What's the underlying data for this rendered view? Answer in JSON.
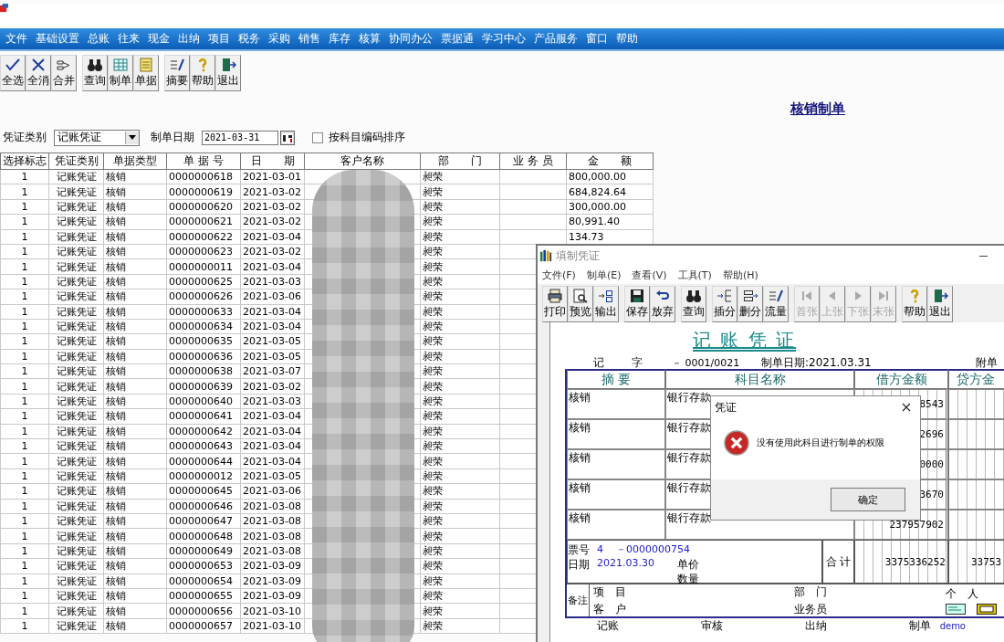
{
  "menu": [
    "文件",
    "基础设置",
    "总账",
    "往来",
    "现金",
    "出纳",
    "项目",
    "税务",
    "采购",
    "销售",
    "库存",
    "核算",
    "协同办公",
    "票据通",
    "学习中心",
    "产品服务",
    "窗口",
    "帮助"
  ],
  "toolbar_groups": [
    [
      "全选",
      "全消",
      "合并"
    ],
    [
      "查询",
      "制单",
      "单据"
    ],
    [
      "摘要",
      "帮助",
      "退出"
    ]
  ],
  "page_title": "核销制单",
  "filters": {
    "voucher_type_label": "凭证类别",
    "voucher_type_value": "记账凭证",
    "date_label": "制单日期",
    "date_value": "2021-03-31",
    "sort_checkbox": {
      "label": "按科目编码排序",
      "checked": false
    }
  },
  "table": {
    "columns": [
      "选择标志",
      "凭证类别",
      "单据类型",
      "单 据 号",
      "日　　期",
      "客户名称",
      "部　　门",
      "业 务 员",
      "金　　额"
    ],
    "rows": [
      {
        "flag": "1",
        "voucher_type": "记账凭证",
        "doc_type": "核销",
        "doc_no": "0000000618",
        "date": "2021-03-01",
        "department": "昶荣",
        "amount": "800,000.00"
      },
      {
        "flag": "1",
        "voucher_type": "记账凭证",
        "doc_type": "核销",
        "doc_no": "0000000619",
        "date": "2021-03-02",
        "department": "昶荣",
        "amount": "684,824.64"
      },
      {
        "flag": "1",
        "voucher_type": "记账凭证",
        "doc_type": "核销",
        "doc_no": "0000000620",
        "date": "2021-03-02",
        "department": "昶荣",
        "amount": "300,000.00"
      },
      {
        "flag": "1",
        "voucher_type": "记账凭证",
        "doc_type": "核销",
        "doc_no": "0000000621",
        "date": "2021-03-02",
        "department": "昶荣",
        "amount": "80,991.40"
      },
      {
        "flag": "1",
        "voucher_type": "记账凭证",
        "doc_type": "核销",
        "doc_no": "0000000622",
        "date": "2021-03-04",
        "department": "昶荣",
        "amount": "134.73"
      },
      {
        "flag": "1",
        "voucher_type": "记账凭证",
        "doc_type": "核销",
        "doc_no": "0000000623",
        "date": "2021-03-02",
        "department": "昶荣"
      },
      {
        "flag": "1",
        "voucher_type": "记账凭证",
        "doc_type": "核销",
        "doc_no": "0000000011",
        "date": "2021-03-04",
        "department": "昶荣"
      },
      {
        "flag": "1",
        "voucher_type": "记账凭证",
        "doc_type": "核销",
        "doc_no": "0000000625",
        "date": "2021-03-03",
        "department": "昶荣"
      },
      {
        "flag": "1",
        "voucher_type": "记账凭证",
        "doc_type": "核销",
        "doc_no": "0000000626",
        "date": "2021-03-06",
        "department": "昶荣"
      },
      {
        "flag": "1",
        "voucher_type": "记账凭证",
        "doc_type": "核销",
        "doc_no": "0000000633",
        "date": "2021-03-04",
        "department": "昶荣"
      },
      {
        "flag": "1",
        "voucher_type": "记账凭证",
        "doc_type": "核销",
        "doc_no": "0000000634",
        "date": "2021-03-04",
        "department": "昶荣"
      },
      {
        "flag": "1",
        "voucher_type": "记账凭证",
        "doc_type": "核销",
        "doc_no": "0000000635",
        "date": "2021-03-05",
        "department": "昶荣"
      },
      {
        "flag": "1",
        "voucher_type": "记账凭证",
        "doc_type": "核销",
        "doc_no": "0000000636",
        "date": "2021-03-05",
        "department": "昶荣"
      },
      {
        "flag": "1",
        "voucher_type": "记账凭证",
        "doc_type": "核销",
        "doc_no": "0000000638",
        "date": "2021-03-07",
        "department": "昶荣"
      },
      {
        "flag": "1",
        "voucher_type": "记账凭证",
        "doc_type": "核销",
        "doc_no": "0000000639",
        "date": "2021-03-02",
        "department": "昶荣"
      },
      {
        "flag": "1",
        "voucher_type": "记账凭证",
        "doc_type": "核销",
        "doc_no": "0000000640",
        "date": "2021-03-03",
        "department": "昶荣"
      },
      {
        "flag": "1",
        "voucher_type": "记账凭证",
        "doc_type": "核销",
        "doc_no": "0000000641",
        "date": "2021-03-04",
        "department": "昶荣"
      },
      {
        "flag": "1",
        "voucher_type": "记账凭证",
        "doc_type": "核销",
        "doc_no": "0000000642",
        "date": "2021-03-04",
        "department": "昶荣"
      },
      {
        "flag": "1",
        "voucher_type": "记账凭证",
        "doc_type": "核销",
        "doc_no": "0000000643",
        "date": "2021-03-04",
        "department": "昶荣"
      },
      {
        "flag": "1",
        "voucher_type": "记账凭证",
        "doc_type": "核销",
        "doc_no": "0000000644",
        "date": "2021-03-04",
        "department": "昶荣"
      },
      {
        "flag": "1",
        "voucher_type": "记账凭证",
        "doc_type": "核销",
        "doc_no": "0000000012",
        "date": "2021-03-05",
        "department": "昶荣"
      },
      {
        "flag": "1",
        "voucher_type": "记账凭证",
        "doc_type": "核销",
        "doc_no": "0000000645",
        "date": "2021-03-06",
        "department": "昶荣"
      },
      {
        "flag": "1",
        "voucher_type": "记账凭证",
        "doc_type": "核销",
        "doc_no": "0000000646",
        "date": "2021-03-08",
        "department": "昶荣"
      },
      {
        "flag": "1",
        "voucher_type": "记账凭证",
        "doc_type": "核销",
        "doc_no": "0000000647",
        "date": "2021-03-08",
        "department": "昶荣"
      },
      {
        "flag": "1",
        "voucher_type": "记账凭证",
        "doc_type": "核销",
        "doc_no": "0000000648",
        "date": "2021-03-08",
        "department": "昶荣"
      },
      {
        "flag": "1",
        "voucher_type": "记账凭证",
        "doc_type": "核销",
        "doc_no": "0000000649",
        "date": "2021-03-08",
        "department": "昶荣"
      },
      {
        "flag": "1",
        "voucher_type": "记账凭证",
        "doc_type": "核销",
        "doc_no": "0000000653",
        "date": "2021-03-09",
        "department": "昶荣"
      },
      {
        "flag": "1",
        "voucher_type": "记账凭证",
        "doc_type": "核销",
        "doc_no": "0000000654",
        "date": "2021-03-09",
        "department": "昶荣"
      },
      {
        "flag": "1",
        "voucher_type": "记账凭证",
        "doc_type": "核销",
        "doc_no": "0000000655",
        "date": "2021-03-09",
        "department": "昶荣"
      },
      {
        "flag": "1",
        "voucher_type": "记账凭证",
        "doc_type": "核销",
        "doc_no": "0000000656",
        "date": "2021-03-10",
        "department": "昶荣"
      },
      {
        "flag": "1",
        "voucher_type": "记账凭证",
        "doc_type": "核销",
        "doc_no": "0000000657",
        "date": "2021-03-10",
        "department": "昶荣"
      }
    ]
  },
  "voucher_window": {
    "title": "填制凭证",
    "menu": [
      "文件(F)",
      "制单(E)",
      "查看(V)",
      "工具(T)",
      "帮助(H)"
    ],
    "toolbar_groups": [
      [
        {
          "label": "打印",
          "disabled": false
        },
        {
          "label": "预览",
          "disabled": false
        },
        {
          "label": "输出",
          "disabled": false
        }
      ],
      [
        {
          "label": "保存",
          "disabled": false
        },
        {
          "label": "放弃",
          "disabled": false
        }
      ],
      [
        {
          "label": "查询",
          "disabled": false
        }
      ],
      [
        {
          "label": "插分",
          "disabled": false
        },
        {
          "label": "删分",
          "disabled": false
        },
        {
          "label": "流量",
          "disabled": false
        }
      ],
      [
        {
          "label": "首张",
          "disabled": true
        },
        {
          "label": "上张",
          "disabled": true
        },
        {
          "label": "下张",
          "disabled": true
        },
        {
          "label": "末张",
          "disabled": true
        }
      ],
      [
        {
          "label": "帮助",
          "disabled": false
        },
        {
          "label": "退出",
          "disabled": false
        }
      ]
    ],
    "heading": "记 账 凭 证",
    "word_label": "记",
    "word_suffix": "字",
    "number": "－ 0001/0021",
    "date": "制单日期:2021.03.31",
    "attachments": "附单",
    "columns": [
      "摘 要",
      "科目名称",
      "借方金额",
      "贷方金"
    ],
    "entries": [
      {
        "summary": "核销",
        "account": "银行存款",
        "debit": "8543"
      },
      {
        "summary": "核销",
        "account": "银行存款",
        "debit": "2696"
      },
      {
        "summary": "核销",
        "account": "银行存款",
        "debit": "0000"
      },
      {
        "summary": "核销",
        "account": "银行存款",
        "debit": "3670"
      },
      {
        "summary": "核销",
        "account": "银行存款",
        "debit": "237957902"
      }
    ],
    "ticket_label": "票号",
    "ticket_type": "4",
    "ticket_no": "－0000000754",
    "date_label": "日期",
    "ticket_date": "2021.03.30",
    "unit_price_label": "单价",
    "quantity_label": "数量",
    "total_label": "合 计",
    "total_debit": "3375336252",
    "total_credit": "33753",
    "remark_label": "备注",
    "project_label": "项　目",
    "customer_label": "客　户",
    "department_label": "部　门",
    "salesperson_label": "业务员",
    "personal_label": "个　人",
    "signatures": [
      {
        "label": "记账"
      },
      {
        "label": "审核"
      },
      {
        "label": "出纳"
      },
      {
        "label": "制单",
        "value": "demo"
      }
    ]
  },
  "dialog": {
    "title": "凭证",
    "message": "没有使用此科目进行制单的权限",
    "button": "确定"
  }
}
